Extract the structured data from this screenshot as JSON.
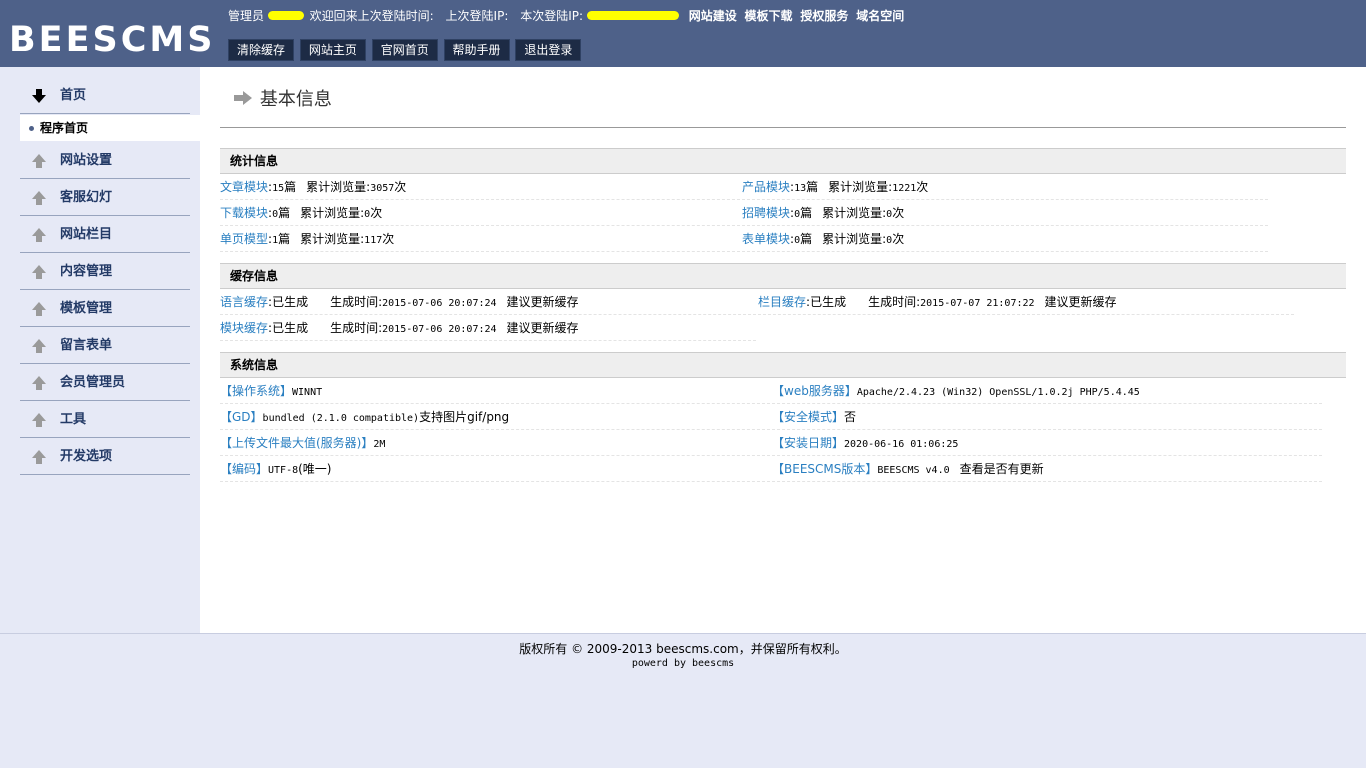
{
  "header": {
    "logo": "BEESCMS",
    "admin_label": "管理员",
    "welcome_text": "欢迎回来上次登陆时间:",
    "last_ip_label": "上次登陆IP:",
    "this_ip_label": "本次登陆IP:",
    "links": [
      "网站建设",
      "模板下载",
      "授权服务",
      "域名空间"
    ],
    "buttons": [
      "清除缓存",
      "网站主页",
      "官网首页",
      "帮助手册",
      "退出登录"
    ],
    "bg_color": "#4e6189"
  },
  "sidebar": {
    "home": "首页",
    "sub_item": "程序首页",
    "items": [
      "网站设置",
      "客服幻灯",
      "网站栏目",
      "内容管理",
      "模板管理",
      "留言表单",
      "会员管理员",
      "工具",
      "开发选项"
    ]
  },
  "main": {
    "title": "基本信息",
    "stats": {
      "title": "统计信息",
      "view_label": "累计浏览量",
      "rows": [
        {
          "name": "文章模块",
          "count": "15",
          "unit": "篇",
          "views": "3057",
          "views_unit": "次"
        },
        {
          "name": "产品模块",
          "count": "13",
          "unit": "篇",
          "views": "1221",
          "views_unit": "次"
        },
        {
          "name": "下载模块",
          "count": "0",
          "unit": "篇",
          "views": "0",
          "views_unit": "次"
        },
        {
          "name": "招聘模块",
          "count": "0",
          "unit": "篇",
          "views": "0",
          "views_unit": "次"
        },
        {
          "name": "单页模型",
          "count": "1",
          "unit": "篇",
          "views": "117",
          "views_unit": "次"
        },
        {
          "name": "表单模块",
          "count": "0",
          "unit": "篇",
          "views": "0",
          "views_unit": "次"
        }
      ]
    },
    "cache": {
      "title": "缓存信息",
      "rows": [
        {
          "name": "语言缓存",
          "status": "已生成",
          "time_label": "生成时间",
          "time": "2015-07-06 20:07:24",
          "advice": "建议更新缓存"
        },
        {
          "name": "栏目缓存",
          "status": "已生成",
          "time_label": "生成时间",
          "time": "2015-07-07 21:07:22",
          "advice": "建议更新缓存"
        },
        {
          "name": "模块缓存",
          "status": "已生成",
          "time_label": "生成时间",
          "time": "2015-07-06 20:07:24",
          "advice": "建议更新缓存"
        }
      ]
    },
    "system": {
      "title": "系统信息",
      "rows": [
        {
          "name": "【操作系统】",
          "value": "WINNT",
          "extra": ""
        },
        {
          "name": "【web服务器】",
          "value": "Apache/2.4.23 (Win32) OpenSSL/1.0.2j PHP/5.4.45",
          "extra": ""
        },
        {
          "name": "【GD】",
          "value": "bundled (2.1.0 compatible)",
          "extra": "支持图片gif/png"
        },
        {
          "name": "【安全模式】",
          "value": "",
          "extra": "否"
        },
        {
          "name": "【上传文件最大值(服务器)】",
          "value": "2M",
          "extra": ""
        },
        {
          "name": "【安装日期】",
          "value": "2020-06-16 01:06:25",
          "extra": ""
        },
        {
          "name": "【编码】",
          "value": "UTF-8",
          "extra": "(唯一)"
        },
        {
          "name": "【BEESCMS版本】",
          "value": "BEESCMS v4.0",
          "extra": "查看是否有更新"
        }
      ]
    }
  },
  "footer": {
    "copyright": "版权所有 © 2009-2013 beescms.com，并保留所有权利。",
    "powered": "powerd by beescms"
  }
}
